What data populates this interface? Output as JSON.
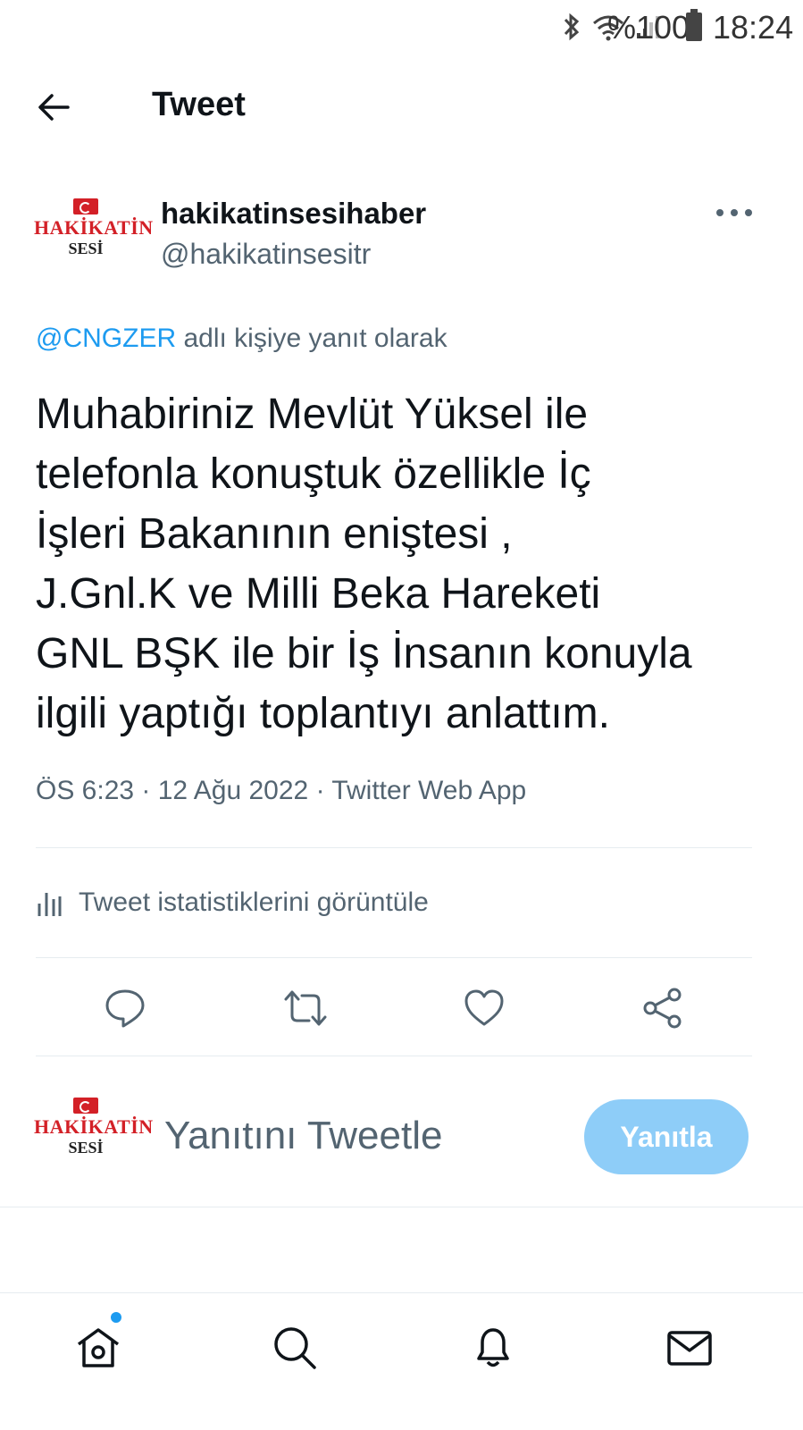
{
  "status_bar": {
    "battery_percent": "%100",
    "time": "18:24",
    "icons": [
      "bluetooth-icon",
      "wifi-icon",
      "signal-icon",
      "battery-icon"
    ]
  },
  "header": {
    "title": "Tweet",
    "back_icon": "arrow-left-icon"
  },
  "author": {
    "display_name": "hakikatinsesihaber",
    "handle": "@hakikatinsesitr",
    "avatar_logo": {
      "line1": "HAKİKATİN",
      "line2": "SESİ"
    },
    "more_icon": "more-horizontal-icon"
  },
  "tweet": {
    "reply_to_mention": "@CNGZER",
    "reply_to_suffix": " adlı kişiye yanıt olarak",
    "text": "Muhabiriniz Mevlüt Yüksel  ile\ntelefonla konuştuk özellikle İç\nİşleri Bakanının eniştesi ,\nJ.Gnl.K ve Milli Beka Hareketi\nGNL BŞK ile bir İş İnsanın konuyla\nilgili yaptığı toplantıyı anlattım.",
    "meta": "ÖS 6:23 · 12 Ağu 2022 · Twitter Web App"
  },
  "stats": {
    "label": "Tweet istatistiklerini görüntüle",
    "icon": "analytics-icon"
  },
  "actions": [
    {
      "name": "reply",
      "icon": "reply-icon"
    },
    {
      "name": "retweet",
      "icon": "retweet-icon"
    },
    {
      "name": "like",
      "icon": "heart-icon"
    },
    {
      "name": "share",
      "icon": "share-icon"
    }
  ],
  "reply_composer": {
    "placeholder": "Yanıtını Tweetle",
    "button_label": "Yanıtla"
  },
  "bottom_nav": [
    {
      "name": "home",
      "icon": "home-icon",
      "has_notification_dot": true
    },
    {
      "name": "search",
      "icon": "search-icon"
    },
    {
      "name": "notifications",
      "icon": "bell-icon"
    },
    {
      "name": "messages",
      "icon": "mail-icon"
    }
  ],
  "colors": {
    "accent": "#1d9bf0",
    "reply_button_disabled": "#8ecdf8",
    "text_primary": "#0f1419",
    "text_secondary": "#536471",
    "logo_red": "#d32027"
  }
}
